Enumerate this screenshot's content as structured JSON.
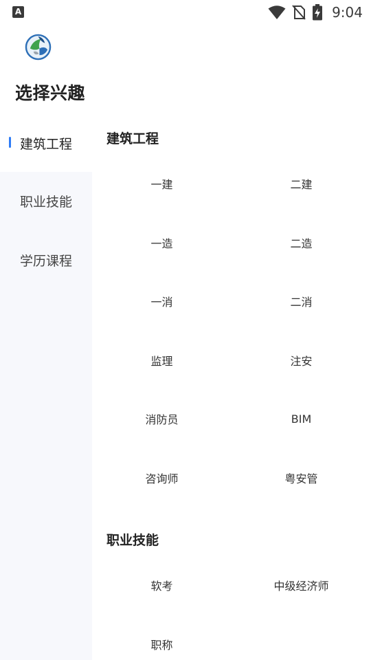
{
  "status_bar": {
    "app_icon_letter": "A",
    "time": "9:04",
    "icons": [
      "wifi-icon",
      "no-sim-icon",
      "battery-charging-icon"
    ]
  },
  "header": {
    "logo_icon": "globe-logo-icon",
    "title": "选择兴趣"
  },
  "sidebar": {
    "items": [
      {
        "label": "建筑工程",
        "active": true
      },
      {
        "label": "职业技能",
        "active": false
      },
      {
        "label": "学历课程",
        "active": false
      }
    ]
  },
  "sections": [
    {
      "title": "建筑工程",
      "items": [
        "一建",
        "二建",
        "一造",
        "二造",
        "一消",
        "二消",
        "监理",
        "注安",
        "消防员",
        "BIM",
        "咨询师",
        "粤安管"
      ]
    },
    {
      "title": "职业技能",
      "items": [
        "软考",
        "中级经济师",
        "职称"
      ]
    }
  ],
  "colors": {
    "accent": "#2f7cf6",
    "sidebar_bg": "#f7f8fc",
    "text_primary": "#222222",
    "text_secondary": "#444444"
  }
}
